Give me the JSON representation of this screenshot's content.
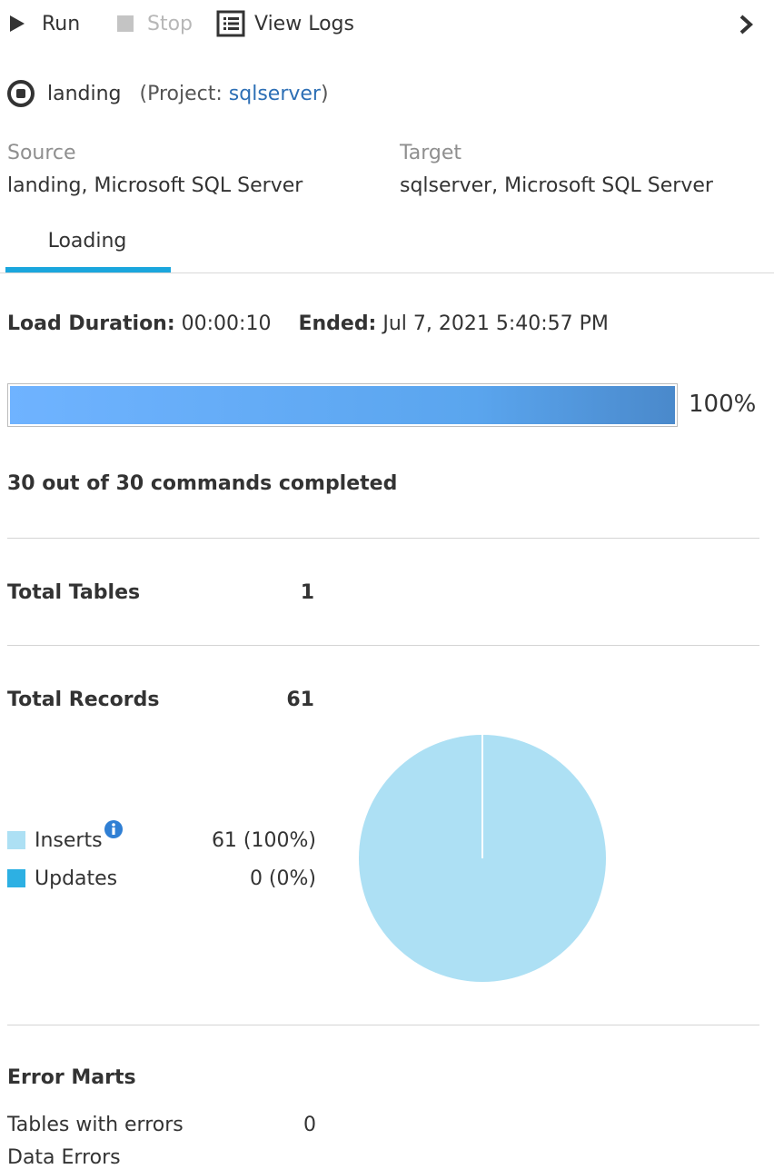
{
  "toolbar": {
    "run_label": "Run",
    "stop_label": "Stop",
    "view_logs_label": "View Logs"
  },
  "task": {
    "name": "landing",
    "project_prefix": "(Project: ",
    "project_name": "sqlserver",
    "project_suffix": ")"
  },
  "endpoints": {
    "source_label": "Source",
    "source_value": "landing, Microsoft SQL Server",
    "target_label": "Target",
    "target_value": "sqlserver, Microsoft SQL Server"
  },
  "tabs": [
    {
      "label": "Loading",
      "active": true
    }
  ],
  "load": {
    "duration_label": "Load Duration:",
    "duration_value": "00:00:10",
    "ended_label": "Ended:",
    "ended_value": "Jul 7, 2021 5:40:57 PM",
    "progress_fraction": 1.0,
    "progress_text": "100%",
    "commands_text": "30 out of 30 commands completed"
  },
  "stats": {
    "total_tables_label": "Total Tables",
    "total_tables_value": "1",
    "total_records_label": "Total Records",
    "total_records_value": "61"
  },
  "legend": [
    {
      "label": "Inserts",
      "value": "61 (100%)",
      "color": "#ade0f4"
    },
    {
      "label": "Updates",
      "value": "0 (0%)",
      "color": "#2db0e3"
    }
  ],
  "chart_data": {
    "type": "pie",
    "categories": [
      "Inserts",
      "Updates"
    ],
    "values": [
      61,
      0
    ],
    "colors": [
      "#ade0f4",
      "#2db0e3"
    ]
  },
  "error_marts": {
    "title": "Error Marts",
    "tables_with_errors_label": "Tables with errors",
    "tables_with_errors_value": "0",
    "data_errors_label": "Data Errors"
  },
  "colors": {
    "accent": "#1aa6dd",
    "link": "#2d6fb5",
    "progress": "#5aa5ee"
  }
}
